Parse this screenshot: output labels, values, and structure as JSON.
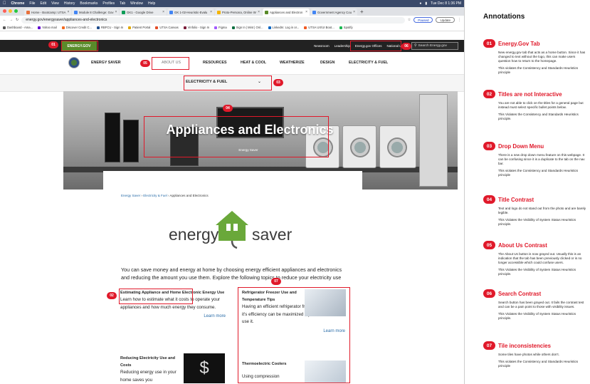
{
  "mac_menu": {
    "app": "Chrome",
    "items": [
      "File",
      "Edit",
      "View",
      "History",
      "Bookmarks",
      "Profiles",
      "Tab",
      "Window",
      "Help"
    ],
    "clock": "Tue Dec 8  1:36 PM"
  },
  "browser": {
    "tabs": [
      {
        "label": "Home - Bootcamp: UTSA",
        "color": "#e8713c"
      },
      {
        "label": "Module 8 Challenge: Gov",
        "color": "#4285f4"
      },
      {
        "label": "GK1 - Google Drive",
        "color": "#0f9d58"
      },
      {
        "label": "GK 1-02-Heuristic-Evalu",
        "color": "#4285f4"
      },
      {
        "label": "Proto-Persona, Online W",
        "color": "#f4b400"
      },
      {
        "label": "Appliances and Electron",
        "color": "#5a8b2a",
        "active": true
      },
      {
        "label": "Government Agency Cou",
        "color": "#4285f4"
      }
    ],
    "url": "energy.gov/energysaver/appliances-and-electronics",
    "paused_label": "Paused",
    "update_label": "Update",
    "bookmarks": [
      "Dashboard - Ama...",
      "Yahoo mail",
      "Discover Credit C...",
      "RBFCU - Sign In",
      "Patient Portal",
      "UTSA Canvas",
      "Vinfolio - Sign In",
      "Figma",
      "Sign In | Mint | Onl...",
      "LinkedIn: Log in or...",
      "UTSA UX/UI Boot...",
      "Spotify"
    ]
  },
  "site": {
    "tab_label": "ENERGY.GOV",
    "top_links": [
      "Newsroom",
      "Leadership",
      "Energy.gov Offices",
      "National Labs"
    ],
    "search_placeholder": "Search Energy.gov",
    "site_name": "ENERGY SAVER",
    "about": "ABOUT US",
    "nav": [
      "RESOURCES",
      "HEAT & COOL",
      "WEATHERIZE",
      "DESIGN",
      "ELECTRICITY & FUEL"
    ],
    "dropdown": "ELECTRICITY & FUEL",
    "hero_title": "Appliances and Electronics",
    "hero_sub": "Energy Saver",
    "breadcrumb": [
      "Energy Saver",
      "Electricity & Fuel",
      "Appliances and Electronics"
    ],
    "logo_left": "energy",
    "logo_right": "saver",
    "intro": "You can save money and energy at home by choosing energy efficient appliances and electronics and reducing the amount you use them. Explore the following topics to reduce your electricity use",
    "cards": [
      {
        "title": "Estimating Appliance and Home Electronic Energy Use",
        "body": "Learn how to estimate what it costs to operate your appliances and how much energy they consume.",
        "more": "Learn more"
      },
      {
        "title": "Refrigerator Freezer Use and Temperature Tips",
        "body": "Having an efficient refrigerator freezer is great, but it's efficiency can be maximized if you know how to use it.",
        "more": "Learn more"
      },
      {
        "title": "Reducing Electricity Use and Costs",
        "body": "Reducing energy use in your home saves you"
      },
      {
        "title": "Thermoelectric Coolers",
        "body": "Using compression"
      }
    ]
  },
  "callouts": [
    "01",
    "02",
    "03",
    "04",
    "05",
    "06",
    "07"
  ],
  "annotations": {
    "title": "Annotations",
    "items": [
      {
        "num": "01",
        "title": "Energy.Gov Tab",
        "paras": [
          "New energy.gov tab that acts as a home button. Since it has changed to text without the logo, this can make users question how to return to the homepage.",
          "This violates the Consistency and Standards Heuristics principle"
        ]
      },
      {
        "num": "02",
        "title": "Titles are not Interactive",
        "paras": [
          "You are not able to click on the titles for a general page but instead must select specific bullet points below.",
          "This Violates the Consistency and Standards Heuristics principle."
        ]
      },
      {
        "num": "03",
        "title": "Drop Down Menu",
        "paras": [
          "There is a new drop down menu feature on this webpage. It can be confusing since it is a duplicate to the tab on the nav bar.",
          "This violates the Consistency and Standards Heuristics principle"
        ]
      },
      {
        "num": "04",
        "title": "Title Contrast",
        "paras": [
          "Text and logo do not stand out from the photo and are barely legible.",
          "This Violates the Visibility of System Status Heuristics principle."
        ]
      },
      {
        "num": "05",
        "title": "About Us Contrast",
        "paras": [
          "The About Us button is now grayed out. Usually this is an indication that the tab has been previously clicked or is no longer accessible which could confuse users.",
          "This Violates the Visibility of System Status Heuristics principle."
        ]
      },
      {
        "num": "06",
        "title": "Search Contrast",
        "paras": [
          "Search button has been grayed out. It fails the contrast test and can be a pain point to those with visibility issues.",
          "This Violates the Visibility of System Status Heuristics principle."
        ]
      },
      {
        "num": "07",
        "title": "Tile inconsistencies",
        "paras": [
          "Some tiles have photos while others don't.",
          "This violates the Consistency and Standards Heuristics principle"
        ]
      }
    ]
  },
  "colors": {
    "accent_red": "#e0192a",
    "energy_green": "#5a8b2a",
    "link_blue": "#2a6da8"
  }
}
